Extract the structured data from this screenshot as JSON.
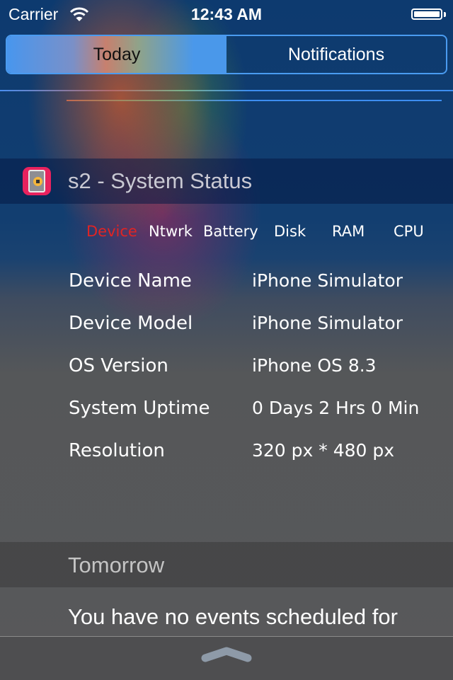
{
  "status_bar": {
    "carrier": "Carrier",
    "time": "12:43 AM",
    "wifi_icon": "wifi-icon",
    "battery_icon": "battery-full-icon"
  },
  "segmented_control": {
    "items": [
      {
        "label": "Today",
        "selected": true
      },
      {
        "label": "Notifications",
        "selected": false
      }
    ]
  },
  "widget": {
    "app_icon": "device-chip-icon",
    "title": "s2 - System Status",
    "accent_color": "#e02424",
    "tabs": [
      {
        "label": "Device",
        "active": true
      },
      {
        "label": "Ntwrk",
        "active": false
      },
      {
        "label": "Battery",
        "active": false
      },
      {
        "label": "Disk",
        "active": false
      },
      {
        "label": "RAM",
        "active": false
      },
      {
        "label": "CPU",
        "active": false
      }
    ],
    "rows": [
      {
        "label": "Device Name",
        "value": "iPhone Simulator"
      },
      {
        "label": "Device Model",
        "value": "iPhone Simulator"
      },
      {
        "label": "OS Version",
        "value": "iPhone OS 8.3"
      },
      {
        "label": "System Uptime",
        "value": "0 Days 2 Hrs 0 Min"
      },
      {
        "label": "Resolution",
        "value": "320 px * 480 px"
      }
    ]
  },
  "tomorrow": {
    "title": "Tomorrow",
    "message": "You have no events scheduled for"
  },
  "bottom": {
    "grabber_icon": "chevron-up-grabber-icon"
  }
}
